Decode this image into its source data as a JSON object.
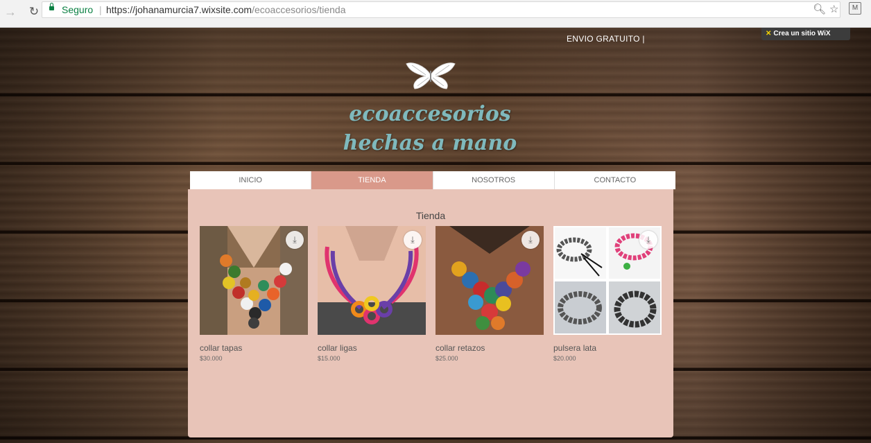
{
  "browser": {
    "secure_label": "Seguro",
    "separator": "|",
    "url_host": "https://johanamurcia7.wixsite.com",
    "url_path": "/ecoaccesorios/tienda"
  },
  "header": {
    "shipping_text": "ENVIO GRATUITO   |",
    "wix_banner": "Crea un sitio WiX",
    "brand_line1": "ecoaccesorios",
    "brand_line2": "hechas a mano"
  },
  "menu": {
    "items": [
      {
        "label": "INICIO",
        "active": false
      },
      {
        "label": "TIENDA",
        "active": true
      },
      {
        "label": "NOSOTROS",
        "active": false
      },
      {
        "label": "CONTACTO",
        "active": false
      }
    ]
  },
  "shop": {
    "title": "Tienda",
    "products": [
      {
        "name": "collar tapas",
        "price": "$30.000",
        "icon": "download-icon"
      },
      {
        "name": "collar ligas",
        "price": "$15.000",
        "icon": "download-icon"
      },
      {
        "name": "collar retazos",
        "price": "$25.000",
        "icon": "download-icon"
      },
      {
        "name": "pulsera lata",
        "price": "$20.000",
        "icon": "download-icon"
      }
    ]
  },
  "colors": {
    "active_tab": "#d9998a",
    "panel": "#e8c4b8",
    "brand_text": "#7fb9bd"
  }
}
